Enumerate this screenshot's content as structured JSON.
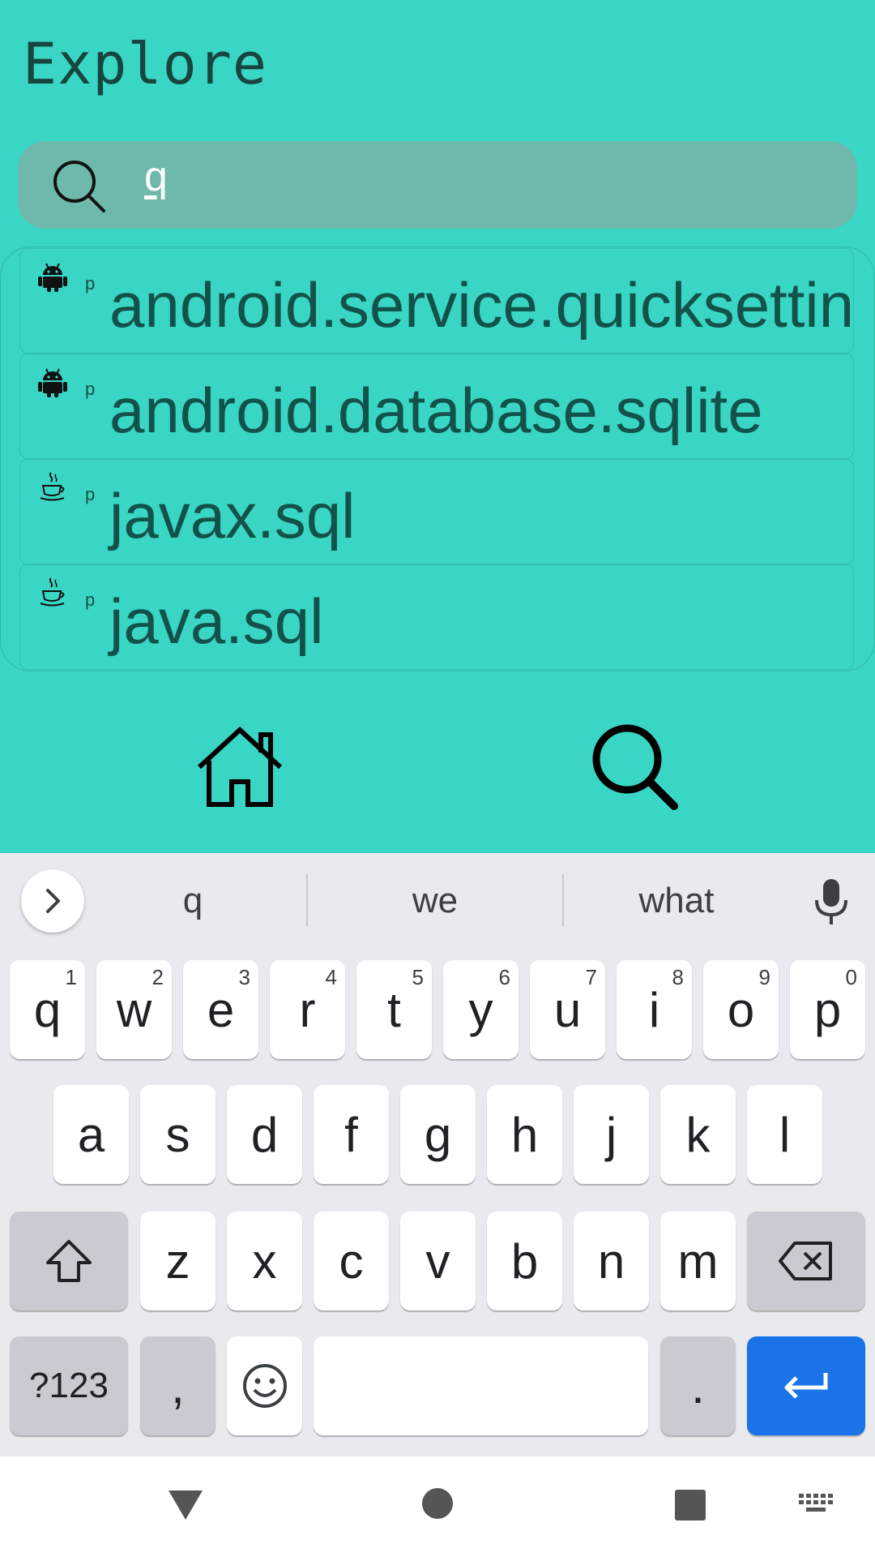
{
  "app": {
    "title": "Explore"
  },
  "search": {
    "query": "q"
  },
  "results": [
    {
      "icon": "android-icon",
      "type": "p",
      "name": "android.service.quicksettings"
    },
    {
      "icon": "android-icon",
      "type": "p",
      "name": "android.database.sqlite"
    },
    {
      "icon": "java-cup-icon",
      "type": "p",
      "name": "javax.sql"
    },
    {
      "icon": "java-cup-icon",
      "type": "p",
      "name": "java.sql"
    }
  ],
  "bottom_nav": {
    "items": [
      "home-icon",
      "search-icon"
    ]
  },
  "keyboard": {
    "suggestions": [
      "q",
      "we",
      "what"
    ],
    "row1": [
      {
        "k": "q",
        "h": "1"
      },
      {
        "k": "w",
        "h": "2"
      },
      {
        "k": "e",
        "h": "3"
      },
      {
        "k": "r",
        "h": "4"
      },
      {
        "k": "t",
        "h": "5"
      },
      {
        "k": "y",
        "h": "6"
      },
      {
        "k": "u",
        "h": "7"
      },
      {
        "k": "i",
        "h": "8"
      },
      {
        "k": "o",
        "h": "9"
      },
      {
        "k": "p",
        "h": "0"
      }
    ],
    "row2": [
      "a",
      "s",
      "d",
      "f",
      "g",
      "h",
      "j",
      "k",
      "l"
    ],
    "row3": [
      "z",
      "x",
      "c",
      "v",
      "b",
      "n",
      "m"
    ],
    "symbols_label": "?123",
    "comma_label": ",",
    "period_label": "."
  },
  "colors": {
    "background": "#3ad6c5",
    "search_bar": "#6fb8ac",
    "result_text": "#13524b",
    "enter_key": "#1a73e8"
  }
}
